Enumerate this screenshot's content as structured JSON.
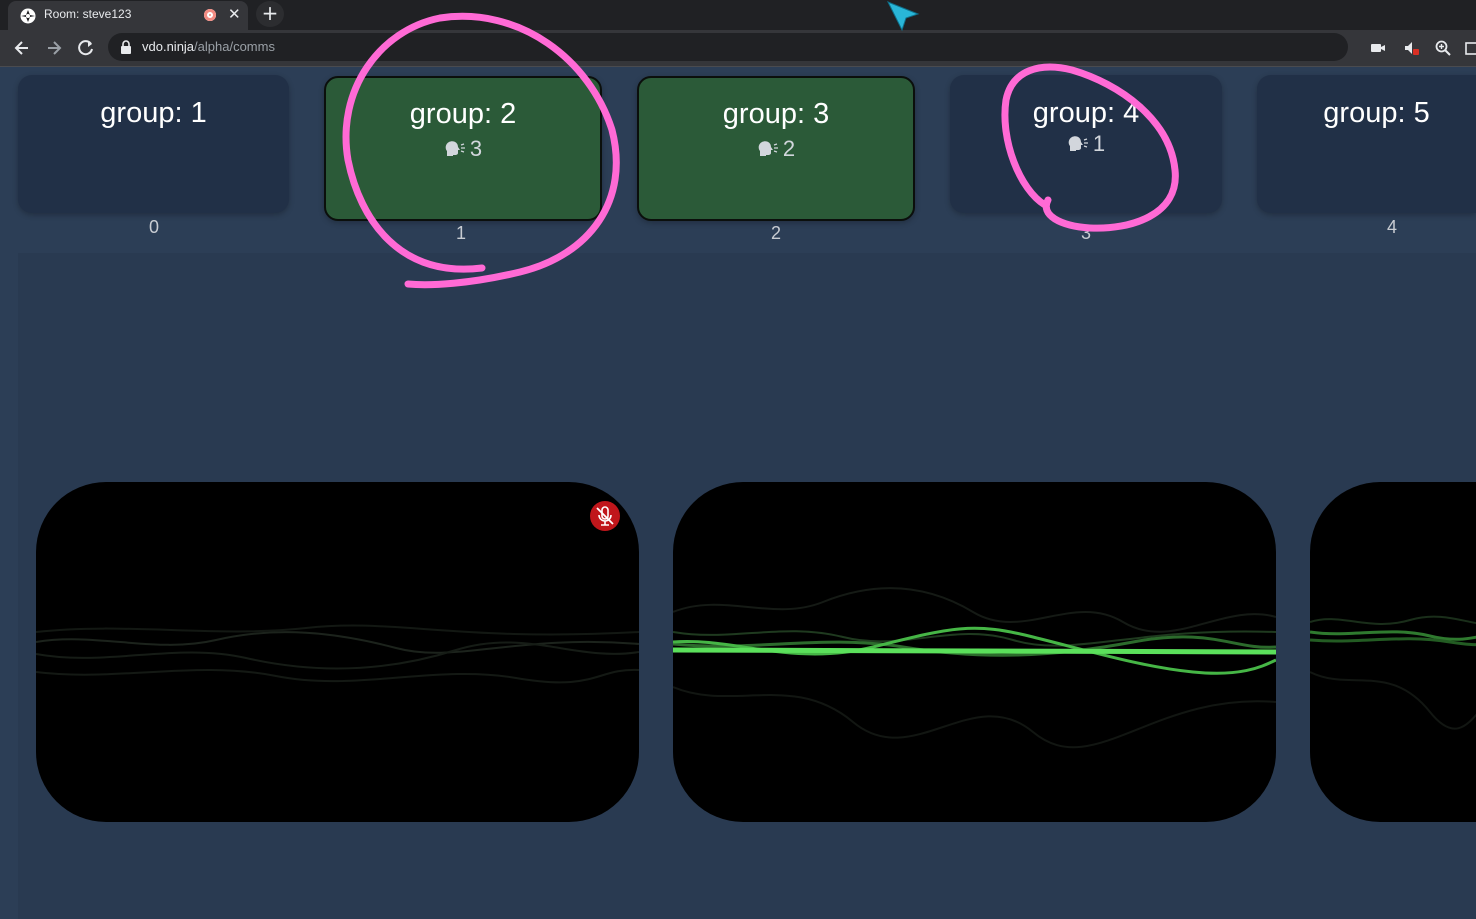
{
  "browser": {
    "tab_title": "Room: steve123",
    "tab_close": "✕",
    "new_tab": "+",
    "url_host": "vdo.ninja",
    "url_path": "/alpha/comms"
  },
  "groups": [
    {
      "name": "group: 1",
      "count": "",
      "index": "0",
      "active": false
    },
    {
      "name": "group: 2",
      "count": "3",
      "index": "1",
      "active": true
    },
    {
      "name": "group: 3",
      "count": "2",
      "index": "2",
      "active": true
    },
    {
      "name": "group: 4",
      "count": "1",
      "index": "3",
      "active": false
    },
    {
      "name": "group: 5",
      "count": "",
      "index": "4",
      "active": false
    }
  ],
  "tiles": [
    {
      "muted": true,
      "wave_color": "#1e2a1e"
    },
    {
      "muted": false,
      "wave_color": "#5be05b"
    },
    {
      "muted": false,
      "wave_color": "#2f7a2f"
    }
  ],
  "colors": {
    "active_group": "#2b5a38",
    "inactive_group": "#213047",
    "annotation": "#ff6ad5",
    "mute_badge": "#c0161b"
  }
}
